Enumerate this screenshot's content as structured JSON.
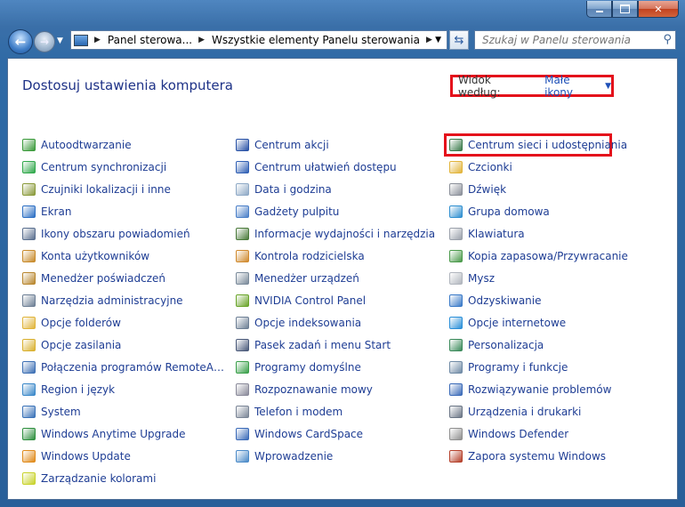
{
  "address_bar": {
    "crumbs": [
      "Panel sterowa...",
      "Wszystkie elementy Panelu sterowania"
    ]
  },
  "search": {
    "placeholder": "Szukaj w Panelu sterowania"
  },
  "header": {
    "title": "Dostosuj ustawienia komputera",
    "view_by_label": "Widok według:",
    "view_by_value": "Małe ikony"
  },
  "columns": [
    [
      {
        "label": "Autoodtwarzanie",
        "icon": "autoplay-icon",
        "color": "#3a9a3a"
      },
      {
        "label": "Centrum synchronizacji",
        "icon": "sync-center-icon",
        "color": "#2fa84a"
      },
      {
        "label": "Czujniki lokalizacji i inne",
        "icon": "location-sensors-icon",
        "color": "#8a9a3a"
      },
      {
        "label": "Ekran",
        "icon": "display-icon",
        "color": "#2c6fc4"
      },
      {
        "label": "Ikony obszaru powiadomień",
        "icon": "notification-icons-icon",
        "color": "#5a6f8f"
      },
      {
        "label": "Konta użytkowników",
        "icon": "user-accounts-icon",
        "color": "#c88a2a"
      },
      {
        "label": "Menedżer poświadczeń",
        "icon": "credential-manager-icon",
        "color": "#b8862d"
      },
      {
        "label": "Narzędzia administracyjne",
        "icon": "admin-tools-icon",
        "color": "#6d7f95"
      },
      {
        "label": "Opcje folderów",
        "icon": "folder-options-icon",
        "color": "#e0b43a"
      },
      {
        "label": "Opcje zasilania",
        "icon": "power-options-icon",
        "color": "#d9b02e"
      },
      {
        "label": "Połączenia programów RemoteApp i ...",
        "icon": "remoteapp-icon",
        "color": "#3c6fb4"
      },
      {
        "label": "Region i język",
        "icon": "region-language-icon",
        "color": "#3a88c9"
      },
      {
        "label": "System",
        "icon": "system-icon",
        "color": "#3a72b8"
      },
      {
        "label": "Windows Anytime Upgrade",
        "icon": "anytime-upgrade-icon",
        "color": "#2e8f3e"
      },
      {
        "label": "Windows Update",
        "icon": "windows-update-icon",
        "color": "#e08a1a"
      },
      {
        "label": "Zarządzanie kolorami",
        "icon": "color-management-icon",
        "color": "#c8d22a"
      }
    ],
    [
      {
        "label": "Centrum akcji",
        "icon": "action-center-icon",
        "color": "#2952a6"
      },
      {
        "label": "Centrum ułatwień dostępu",
        "icon": "ease-of-access-icon",
        "color": "#2f5fb4"
      },
      {
        "label": "Data i godzina",
        "icon": "date-time-icon",
        "color": "#8ea9c6"
      },
      {
        "label": "Gadżety pulpitu",
        "icon": "desktop-gadgets-icon",
        "color": "#4a7fc8"
      },
      {
        "label": "Informacje wydajności i narzędzia",
        "icon": "performance-icon",
        "color": "#4a7a3a"
      },
      {
        "label": "Kontrola rodzicielska",
        "icon": "parental-controls-icon",
        "color": "#d08a2e"
      },
      {
        "label": "Menedżer urządzeń",
        "icon": "device-manager-icon",
        "color": "#7a8a9a"
      },
      {
        "label": "NVIDIA Control Panel",
        "icon": "nvidia-icon",
        "color": "#6aa52a"
      },
      {
        "label": "Opcje indeksowania",
        "icon": "indexing-options-icon",
        "color": "#6d7f95"
      },
      {
        "label": "Pasek zadań i menu Start",
        "icon": "taskbar-icon",
        "color": "#4a5a7a"
      },
      {
        "label": "Programy domyślne",
        "icon": "default-programs-icon",
        "color": "#3aa04a"
      },
      {
        "label": "Rozpoznawanie mowy",
        "icon": "speech-recognition-icon",
        "color": "#8a8a9a"
      },
      {
        "label": "Telefon i modem",
        "icon": "phone-modem-icon",
        "color": "#7a8596"
      },
      {
        "label": "Windows CardSpace",
        "icon": "cardspace-icon",
        "color": "#3a6ab8"
      },
      {
        "label": "Wprowadzenie",
        "icon": "getting-started-icon",
        "color": "#4a8ac8"
      }
    ],
    [
      {
        "label": "Centrum sieci i udostępniania",
        "icon": "network-sharing-icon",
        "color": "#3a7a4a"
      },
      {
        "label": "Czcionki",
        "icon": "fonts-icon",
        "color": "#e2b43a"
      },
      {
        "label": "Dźwięk",
        "icon": "sound-icon",
        "color": "#8a8f99"
      },
      {
        "label": "Grupa domowa",
        "icon": "homegroup-icon",
        "color": "#2f8fd0"
      },
      {
        "label": "Klawiatura",
        "icon": "keyboard-icon",
        "color": "#9aa0aa"
      },
      {
        "label": "Kopia zapasowa/Przywracanie",
        "icon": "backup-restore-icon",
        "color": "#4a9a4a"
      },
      {
        "label": "Mysz",
        "icon": "mouse-icon",
        "color": "#b0b5bd"
      },
      {
        "label": "Odzyskiwanie",
        "icon": "recovery-icon",
        "color": "#3a7ac8"
      },
      {
        "label": "Opcje internetowe",
        "icon": "internet-options-icon",
        "color": "#2a8fd8"
      },
      {
        "label": "Personalizacja",
        "icon": "personalization-icon",
        "color": "#3a8a5a"
      },
      {
        "label": "Programy i funkcje",
        "icon": "programs-features-icon",
        "color": "#6f8aa5"
      },
      {
        "label": "Rozwiązywanie problemów",
        "icon": "troubleshooting-icon",
        "color": "#3a6ab8"
      },
      {
        "label": "Urządzenia i drukarki",
        "icon": "devices-printers-icon",
        "color": "#6a7585"
      },
      {
        "label": "Windows Defender",
        "icon": "windows-defender-icon",
        "color": "#8f8f8f"
      },
      {
        "label": "Zapora systemu Windows",
        "icon": "firewall-icon",
        "color": "#b5402a"
      }
    ]
  ]
}
